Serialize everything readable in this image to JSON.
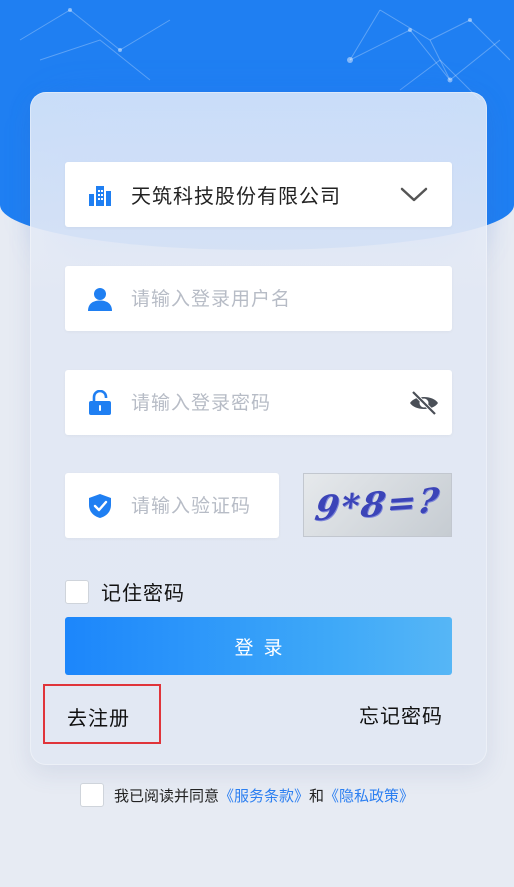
{
  "company": {
    "name": "天筑科技股份有限公司"
  },
  "username": {
    "placeholder": "请输入登录用户名"
  },
  "password": {
    "placeholder": "请输入登录密码"
  },
  "captcha": {
    "placeholder": "请输入验证码",
    "image_text": "9*8=?"
  },
  "remember": {
    "label": "记住密码"
  },
  "login": {
    "label": "登录"
  },
  "links": {
    "register": "去注册",
    "forgot": "忘记密码"
  },
  "agreement": {
    "prefix": "我已阅读并同意",
    "terms": "《服务条款》",
    "and": "和",
    "privacy": "《隐私政策》"
  },
  "colors": {
    "brand_blue": "#1f7ff2",
    "link_blue": "#2c7ff1",
    "highlight_red": "#e0343a"
  }
}
